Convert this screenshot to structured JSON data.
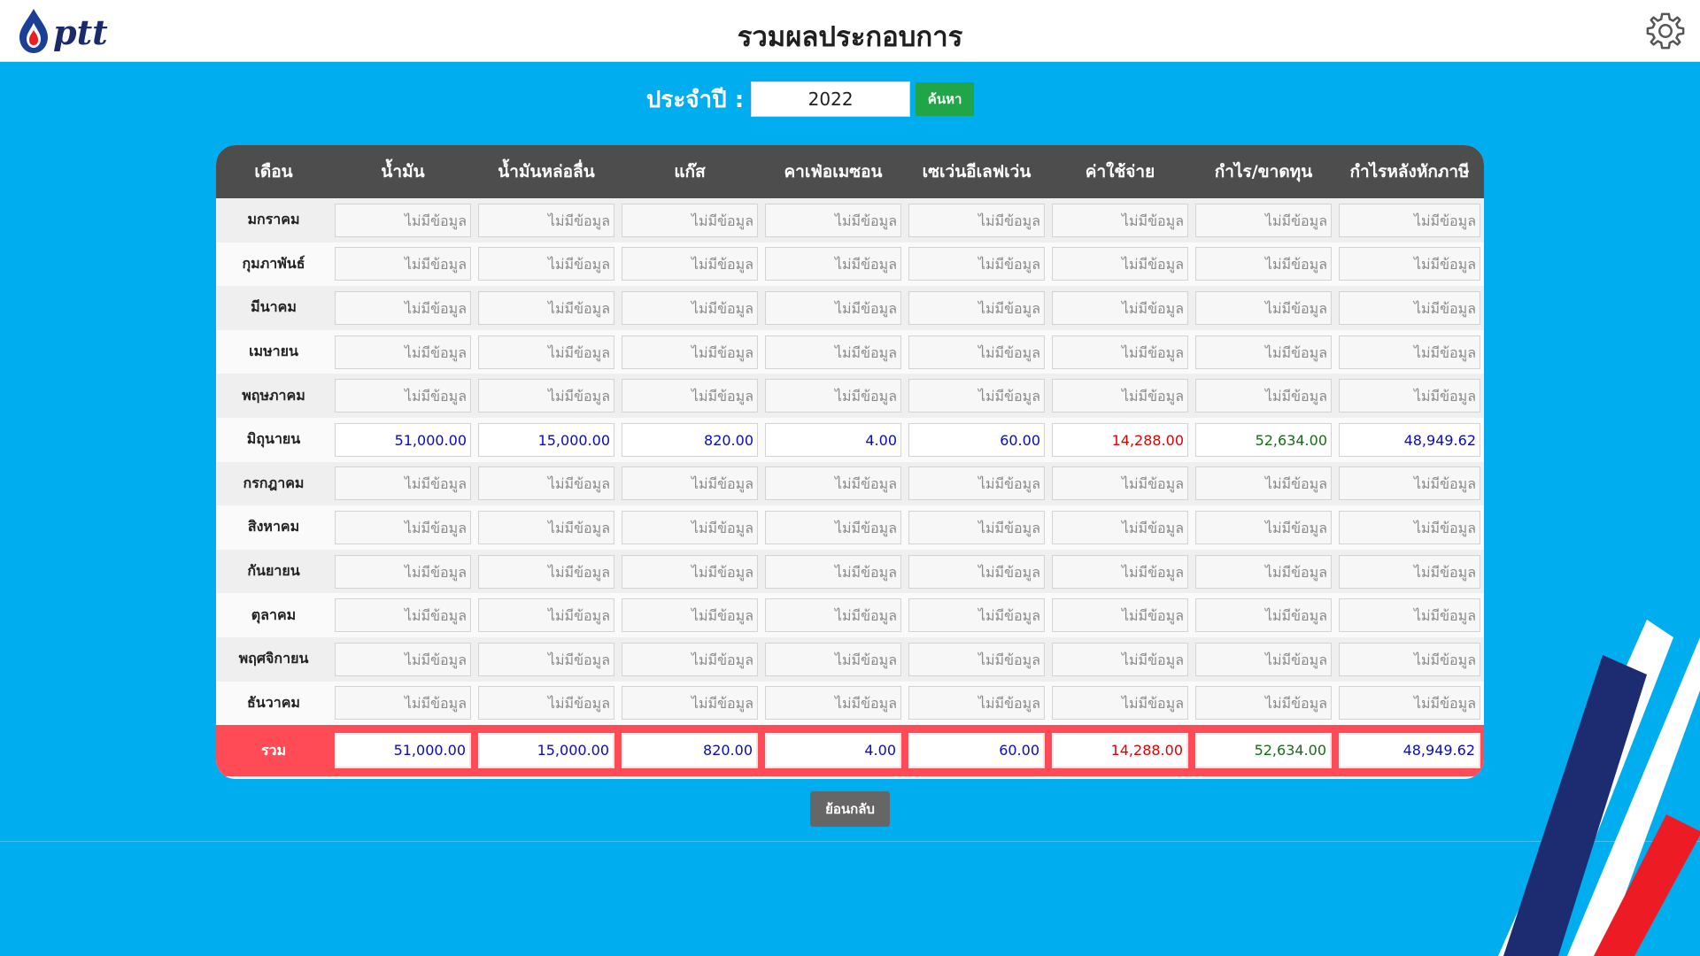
{
  "header": {
    "title": "รวมผลประกอบการ",
    "logo_text": "ptt"
  },
  "filter": {
    "label": "ประจำปี :",
    "year_value": "2022",
    "search_label": "ค้นหา"
  },
  "table": {
    "columns": [
      "เดือน",
      "น้ำมัน",
      "น้ำมันหล่อลื่น",
      "แก๊ส",
      "คาเฟ่อเมซอน",
      "เซเว่นอีเลฟเว่น",
      "ค่าใช้จ่าย",
      "กำไร/ขาดทุน",
      "กำไรหลังหักภาษี"
    ],
    "rows": [
      {
        "month": "มกราคม",
        "values": [
          "ไม่มีข้อมูล",
          "ไม่มีข้อมูล",
          "ไม่มีข้อมูล",
          "ไม่มีข้อมูล",
          "ไม่มีข้อมูล",
          "ไม่มีข้อมูล",
          "ไม่มีข้อมูล",
          "ไม่มีข้อมูล"
        ]
      },
      {
        "month": "กุมภาพันธ์",
        "values": [
          "ไม่มีข้อมูล",
          "ไม่มีข้อมูล",
          "ไม่มีข้อมูล",
          "ไม่มีข้อมูล",
          "ไม่มีข้อมูล",
          "ไม่มีข้อมูล",
          "ไม่มีข้อมูล",
          "ไม่มีข้อมูล"
        ]
      },
      {
        "month": "มีนาคม",
        "values": [
          "ไม่มีข้อมูล",
          "ไม่มีข้อมูล",
          "ไม่มีข้อมูล",
          "ไม่มีข้อมูล",
          "ไม่มีข้อมูล",
          "ไม่มีข้อมูล",
          "ไม่มีข้อมูล",
          "ไม่มีข้อมูล"
        ]
      },
      {
        "month": "เมษายน",
        "values": [
          "ไม่มีข้อมูล",
          "ไม่มีข้อมูล",
          "ไม่มีข้อมูล",
          "ไม่มีข้อมูล",
          "ไม่มีข้อมูล",
          "ไม่มีข้อมูล",
          "ไม่มีข้อมูล",
          "ไม่มีข้อมูล"
        ]
      },
      {
        "month": "พฤษภาคม",
        "values": [
          "ไม่มีข้อมูล",
          "ไม่มีข้อมูล",
          "ไม่มีข้อมูล",
          "ไม่มีข้อมูล",
          "ไม่มีข้อมูล",
          "ไม่มีข้อมูล",
          "ไม่มีข้อมูล",
          "ไม่มีข้อมูล"
        ]
      },
      {
        "month": "มิถุนายน",
        "values": [
          "51,000.00",
          "15,000.00",
          "820.00",
          "4.00",
          "60.00",
          "14,288.00",
          "52,634.00",
          "48,949.62"
        ]
      },
      {
        "month": "กรกฎาคม",
        "values": [
          "ไม่มีข้อมูล",
          "ไม่มีข้อมูล",
          "ไม่มีข้อมูล",
          "ไม่มีข้อมูล",
          "ไม่มีข้อมูล",
          "ไม่มีข้อมูล",
          "ไม่มีข้อมูล",
          "ไม่มีข้อมูล"
        ]
      },
      {
        "month": "สิงหาคม",
        "values": [
          "ไม่มีข้อมูล",
          "ไม่มีข้อมูล",
          "ไม่มีข้อมูล",
          "ไม่มีข้อมูล",
          "ไม่มีข้อมูล",
          "ไม่มีข้อมูล",
          "ไม่มีข้อมูล",
          "ไม่มีข้อมูล"
        ]
      },
      {
        "month": "กันยายน",
        "values": [
          "ไม่มีข้อมูล",
          "ไม่มีข้อมูล",
          "ไม่มีข้อมูล",
          "ไม่มีข้อมูล",
          "ไม่มีข้อมูล",
          "ไม่มีข้อมูล",
          "ไม่มีข้อมูล",
          "ไม่มีข้อมูล"
        ]
      },
      {
        "month": "ตุลาคม",
        "values": [
          "ไม่มีข้อมูล",
          "ไม่มีข้อมูล",
          "ไม่มีข้อมูล",
          "ไม่มีข้อมูล",
          "ไม่มีข้อมูล",
          "ไม่มีข้อมูล",
          "ไม่มีข้อมูล",
          "ไม่มีข้อมูล"
        ]
      },
      {
        "month": "พฤศจิกายน",
        "values": [
          "ไม่มีข้อมูล",
          "ไม่มีข้อมูล",
          "ไม่มีข้อมูล",
          "ไม่มีข้อมูล",
          "ไม่มีข้อมูล",
          "ไม่มีข้อมูล",
          "ไม่มีข้อมูล",
          "ไม่มีข้อมูล"
        ]
      },
      {
        "month": "ธันวาคม",
        "values": [
          "ไม่มีข้อมูล",
          "ไม่มีข้อมูล",
          "ไม่มีข้อมูล",
          "ไม่มีข้อมูล",
          "ไม่มีข้อมูล",
          "ไม่มีข้อมูล",
          "ไม่มีข้อมูล",
          "ไม่มีข้อมูล"
        ]
      }
    ],
    "total": {
      "label": "รวม",
      "values": [
        "51,000.00",
        "15,000.00",
        "820.00",
        "4.00",
        "60.00",
        "14,288.00",
        "52,634.00",
        "48,949.62"
      ]
    },
    "value_colors": [
      "blue",
      "blue",
      "blue",
      "blue",
      "blue",
      "red",
      "green",
      "blue"
    ],
    "empty_text": "ไม่มีข้อมูล"
  },
  "back_label": "ย้อนกลับ",
  "colors": {
    "background": "#00aeef",
    "header_row": "#4d4d4d",
    "total_row": "#ff4b55",
    "search_button": "#21a549",
    "back_button": "#666666",
    "positive_blue": "#0a0ac8",
    "expense_red": "#e00000",
    "profit_green": "#1a6b1a"
  }
}
